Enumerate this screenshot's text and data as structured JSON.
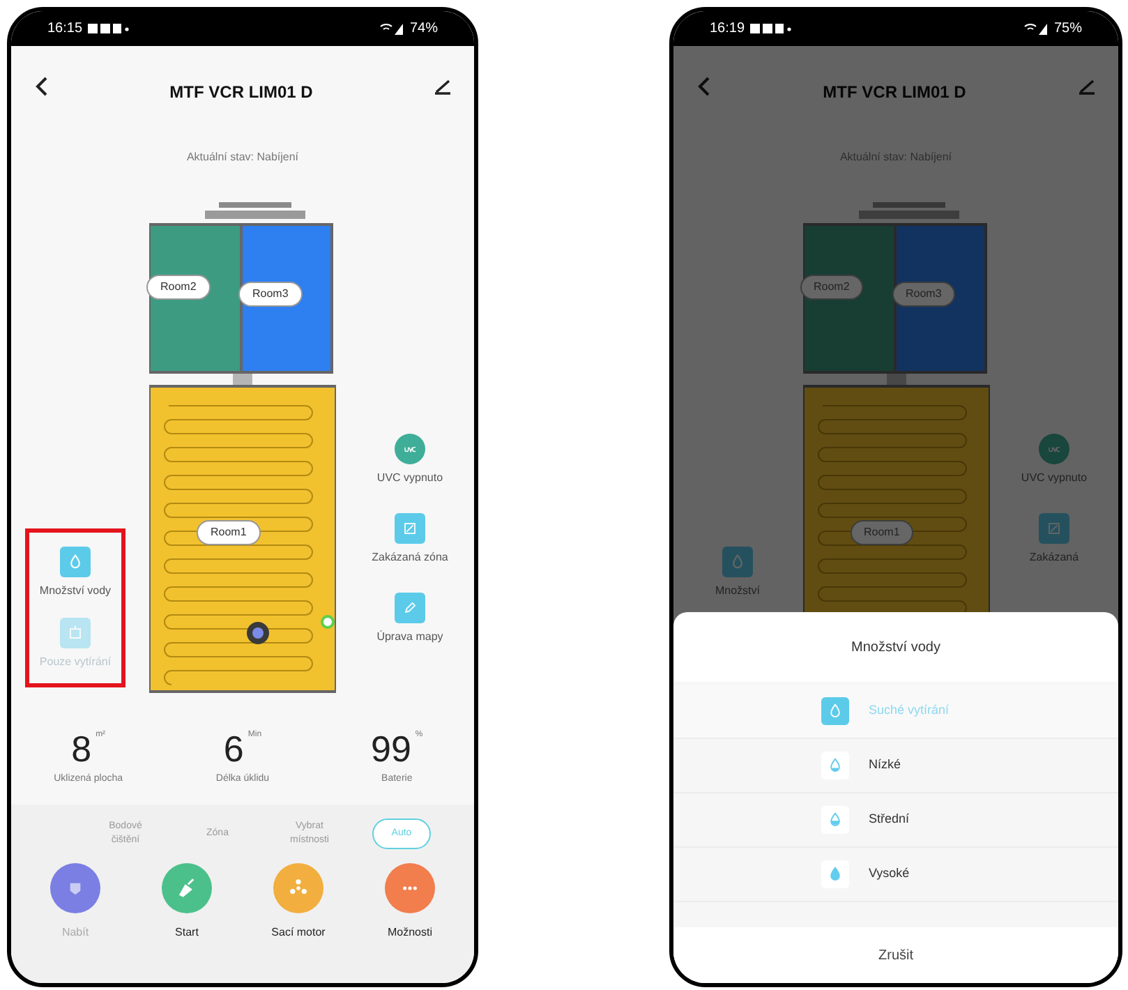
{
  "phones": [
    {
      "status_bar": {
        "time": "16:15",
        "battery": "74%"
      },
      "title": "MTF VCR LIM01 D",
      "status": "Aktuální stav: Nabíjení",
      "dimmed": false,
      "map": {
        "rooms": [
          {
            "label": "Room2",
            "color": "#3d9b82"
          },
          {
            "label": "Room3",
            "color": "#2e7ff0"
          },
          {
            "label": "Room1",
            "color": "#f2c12e"
          }
        ]
      },
      "left_tools": {
        "annotated": true,
        "items": [
          {
            "label": "Množství vody",
            "kind": "water",
            "disabled": false
          },
          {
            "label": "Pouze vytírání",
            "kind": "mop",
            "disabled": true
          }
        ]
      },
      "right_tools": [
        {
          "label": "UVC vypnuto",
          "kind": "uvc"
        },
        {
          "label": "Zakázaná zóna",
          "kind": "zone"
        },
        {
          "label": "Úprava mapy",
          "kind": "edit"
        }
      ],
      "stats": [
        {
          "value": "8",
          "unit": "m²",
          "label": "Uklizená plocha"
        },
        {
          "value": "6",
          "unit": "Min",
          "label": "Délka úklidu"
        },
        {
          "value": "99",
          "unit": "%",
          "label": "Baterie"
        }
      ],
      "modes": [
        {
          "label": "Bodové čištění",
          "selected": false
        },
        {
          "label": "Zóna",
          "selected": false
        },
        {
          "label": "Vybrat místnosti",
          "selected": false
        },
        {
          "label": "Auto",
          "selected": true
        }
      ],
      "actions": [
        {
          "label": "Nabít",
          "kind": "charge",
          "disabled": true
        },
        {
          "label": "Start",
          "kind": "start",
          "disabled": false
        },
        {
          "label": "Sací motor",
          "kind": "fan",
          "disabled": false
        },
        {
          "label": "Možnosti",
          "kind": "more",
          "disabled": false
        }
      ]
    },
    {
      "status_bar": {
        "time": "16:19",
        "battery": "75%"
      },
      "title": "MTF VCR LIM01 D",
      "status": "Aktuální stav: Nabíjení",
      "dimmed": true,
      "map": {
        "rooms": [
          {
            "label": "Room2",
            "color": "#183e34"
          },
          {
            "label": "Room3",
            "color": "#123360"
          },
          {
            "label": "Room1",
            "color": "#614d12"
          }
        ]
      },
      "left_tools": {
        "annotated": false,
        "items": [
          {
            "label": "Množství",
            "kind": "water",
            "disabled": false
          }
        ]
      },
      "right_tools": [
        {
          "label": "UVC vypnuto",
          "kind": "uvc"
        },
        {
          "label": "Zakázaná",
          "kind": "zone"
        }
      ],
      "sheet": {
        "title": "Množství vody",
        "cancel": "Zrušit",
        "options": [
          {
            "label": "Suché vytírání",
            "kind": "dry",
            "selected": true
          },
          {
            "label": "Nízké",
            "kind": "low",
            "selected": false
          },
          {
            "label": "Střední",
            "kind": "medium",
            "selected": false
          },
          {
            "label": "Vysoké",
            "kind": "high",
            "selected": false
          }
        ]
      }
    }
  ]
}
